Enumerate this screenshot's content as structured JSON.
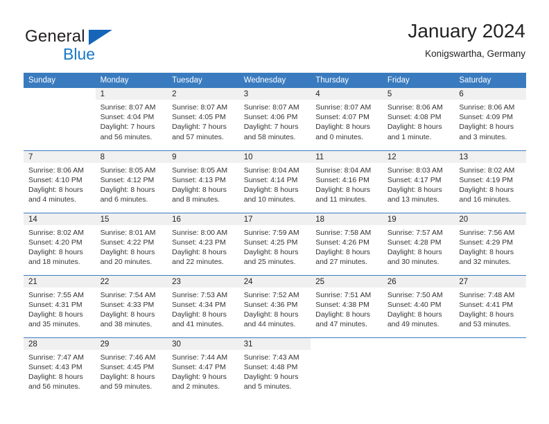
{
  "brand": {
    "name_top": "General",
    "name_bottom": "Blue",
    "triangle_color": "#1565b8",
    "blue_text_color": "#1878c8"
  },
  "header": {
    "month_title": "January 2024",
    "location": "Konigswartha, Germany"
  },
  "theme": {
    "header_blue": "#3a7bbf",
    "daynum_bg": "#f0f0f0",
    "text": "#222222"
  },
  "calendar": {
    "weekday_headers": [
      "Sunday",
      "Monday",
      "Tuesday",
      "Wednesday",
      "Thursday",
      "Friday",
      "Saturday"
    ],
    "weeks": [
      [
        {
          "day": "",
          "sunrise": "",
          "sunset": "",
          "daylight_a": "",
          "daylight_b": ""
        },
        {
          "day": "1",
          "sunrise": "Sunrise: 8:07 AM",
          "sunset": "Sunset: 4:04 PM",
          "daylight_a": "Daylight: 7 hours",
          "daylight_b": "and 56 minutes."
        },
        {
          "day": "2",
          "sunrise": "Sunrise: 8:07 AM",
          "sunset": "Sunset: 4:05 PM",
          "daylight_a": "Daylight: 7 hours",
          "daylight_b": "and 57 minutes."
        },
        {
          "day": "3",
          "sunrise": "Sunrise: 8:07 AM",
          "sunset": "Sunset: 4:06 PM",
          "daylight_a": "Daylight: 7 hours",
          "daylight_b": "and 58 minutes."
        },
        {
          "day": "4",
          "sunrise": "Sunrise: 8:07 AM",
          "sunset": "Sunset: 4:07 PM",
          "daylight_a": "Daylight: 8 hours",
          "daylight_b": "and 0 minutes."
        },
        {
          "day": "5",
          "sunrise": "Sunrise: 8:06 AM",
          "sunset": "Sunset: 4:08 PM",
          "daylight_a": "Daylight: 8 hours",
          "daylight_b": "and 1 minute."
        },
        {
          "day": "6",
          "sunrise": "Sunrise: 8:06 AM",
          "sunset": "Sunset: 4:09 PM",
          "daylight_a": "Daylight: 8 hours",
          "daylight_b": "and 3 minutes."
        }
      ],
      [
        {
          "day": "7",
          "sunrise": "Sunrise: 8:06 AM",
          "sunset": "Sunset: 4:10 PM",
          "daylight_a": "Daylight: 8 hours",
          "daylight_b": "and 4 minutes."
        },
        {
          "day": "8",
          "sunrise": "Sunrise: 8:05 AM",
          "sunset": "Sunset: 4:12 PM",
          "daylight_a": "Daylight: 8 hours",
          "daylight_b": "and 6 minutes."
        },
        {
          "day": "9",
          "sunrise": "Sunrise: 8:05 AM",
          "sunset": "Sunset: 4:13 PM",
          "daylight_a": "Daylight: 8 hours",
          "daylight_b": "and 8 minutes."
        },
        {
          "day": "10",
          "sunrise": "Sunrise: 8:04 AM",
          "sunset": "Sunset: 4:14 PM",
          "daylight_a": "Daylight: 8 hours",
          "daylight_b": "and 10 minutes."
        },
        {
          "day": "11",
          "sunrise": "Sunrise: 8:04 AM",
          "sunset": "Sunset: 4:16 PM",
          "daylight_a": "Daylight: 8 hours",
          "daylight_b": "and 11 minutes."
        },
        {
          "day": "12",
          "sunrise": "Sunrise: 8:03 AM",
          "sunset": "Sunset: 4:17 PM",
          "daylight_a": "Daylight: 8 hours",
          "daylight_b": "and 13 minutes."
        },
        {
          "day": "13",
          "sunrise": "Sunrise: 8:02 AM",
          "sunset": "Sunset: 4:19 PM",
          "daylight_a": "Daylight: 8 hours",
          "daylight_b": "and 16 minutes."
        }
      ],
      [
        {
          "day": "14",
          "sunrise": "Sunrise: 8:02 AM",
          "sunset": "Sunset: 4:20 PM",
          "daylight_a": "Daylight: 8 hours",
          "daylight_b": "and 18 minutes."
        },
        {
          "day": "15",
          "sunrise": "Sunrise: 8:01 AM",
          "sunset": "Sunset: 4:22 PM",
          "daylight_a": "Daylight: 8 hours",
          "daylight_b": "and 20 minutes."
        },
        {
          "day": "16",
          "sunrise": "Sunrise: 8:00 AM",
          "sunset": "Sunset: 4:23 PM",
          "daylight_a": "Daylight: 8 hours",
          "daylight_b": "and 22 minutes."
        },
        {
          "day": "17",
          "sunrise": "Sunrise: 7:59 AM",
          "sunset": "Sunset: 4:25 PM",
          "daylight_a": "Daylight: 8 hours",
          "daylight_b": "and 25 minutes."
        },
        {
          "day": "18",
          "sunrise": "Sunrise: 7:58 AM",
          "sunset": "Sunset: 4:26 PM",
          "daylight_a": "Daylight: 8 hours",
          "daylight_b": "and 27 minutes."
        },
        {
          "day": "19",
          "sunrise": "Sunrise: 7:57 AM",
          "sunset": "Sunset: 4:28 PM",
          "daylight_a": "Daylight: 8 hours",
          "daylight_b": "and 30 minutes."
        },
        {
          "day": "20",
          "sunrise": "Sunrise: 7:56 AM",
          "sunset": "Sunset: 4:29 PM",
          "daylight_a": "Daylight: 8 hours",
          "daylight_b": "and 32 minutes."
        }
      ],
      [
        {
          "day": "21",
          "sunrise": "Sunrise: 7:55 AM",
          "sunset": "Sunset: 4:31 PM",
          "daylight_a": "Daylight: 8 hours",
          "daylight_b": "and 35 minutes."
        },
        {
          "day": "22",
          "sunrise": "Sunrise: 7:54 AM",
          "sunset": "Sunset: 4:33 PM",
          "daylight_a": "Daylight: 8 hours",
          "daylight_b": "and 38 minutes."
        },
        {
          "day": "23",
          "sunrise": "Sunrise: 7:53 AM",
          "sunset": "Sunset: 4:34 PM",
          "daylight_a": "Daylight: 8 hours",
          "daylight_b": "and 41 minutes."
        },
        {
          "day": "24",
          "sunrise": "Sunrise: 7:52 AM",
          "sunset": "Sunset: 4:36 PM",
          "daylight_a": "Daylight: 8 hours",
          "daylight_b": "and 44 minutes."
        },
        {
          "day": "25",
          "sunrise": "Sunrise: 7:51 AM",
          "sunset": "Sunset: 4:38 PM",
          "daylight_a": "Daylight: 8 hours",
          "daylight_b": "and 47 minutes."
        },
        {
          "day": "26",
          "sunrise": "Sunrise: 7:50 AM",
          "sunset": "Sunset: 4:40 PM",
          "daylight_a": "Daylight: 8 hours",
          "daylight_b": "and 49 minutes."
        },
        {
          "day": "27",
          "sunrise": "Sunrise: 7:48 AM",
          "sunset": "Sunset: 4:41 PM",
          "daylight_a": "Daylight: 8 hours",
          "daylight_b": "and 53 minutes."
        }
      ],
      [
        {
          "day": "28",
          "sunrise": "Sunrise: 7:47 AM",
          "sunset": "Sunset: 4:43 PM",
          "daylight_a": "Daylight: 8 hours",
          "daylight_b": "and 56 minutes."
        },
        {
          "day": "29",
          "sunrise": "Sunrise: 7:46 AM",
          "sunset": "Sunset: 4:45 PM",
          "daylight_a": "Daylight: 8 hours",
          "daylight_b": "and 59 minutes."
        },
        {
          "day": "30",
          "sunrise": "Sunrise: 7:44 AM",
          "sunset": "Sunset: 4:47 PM",
          "daylight_a": "Daylight: 9 hours",
          "daylight_b": "and 2 minutes."
        },
        {
          "day": "31",
          "sunrise": "Sunrise: 7:43 AM",
          "sunset": "Sunset: 4:48 PM",
          "daylight_a": "Daylight: 9 hours",
          "daylight_b": "and 5 minutes."
        },
        {
          "day": "",
          "sunrise": "",
          "sunset": "",
          "daylight_a": "",
          "daylight_b": ""
        },
        {
          "day": "",
          "sunrise": "",
          "sunset": "",
          "daylight_a": "",
          "daylight_b": ""
        },
        {
          "day": "",
          "sunrise": "",
          "sunset": "",
          "daylight_a": "",
          "daylight_b": ""
        }
      ]
    ]
  }
}
